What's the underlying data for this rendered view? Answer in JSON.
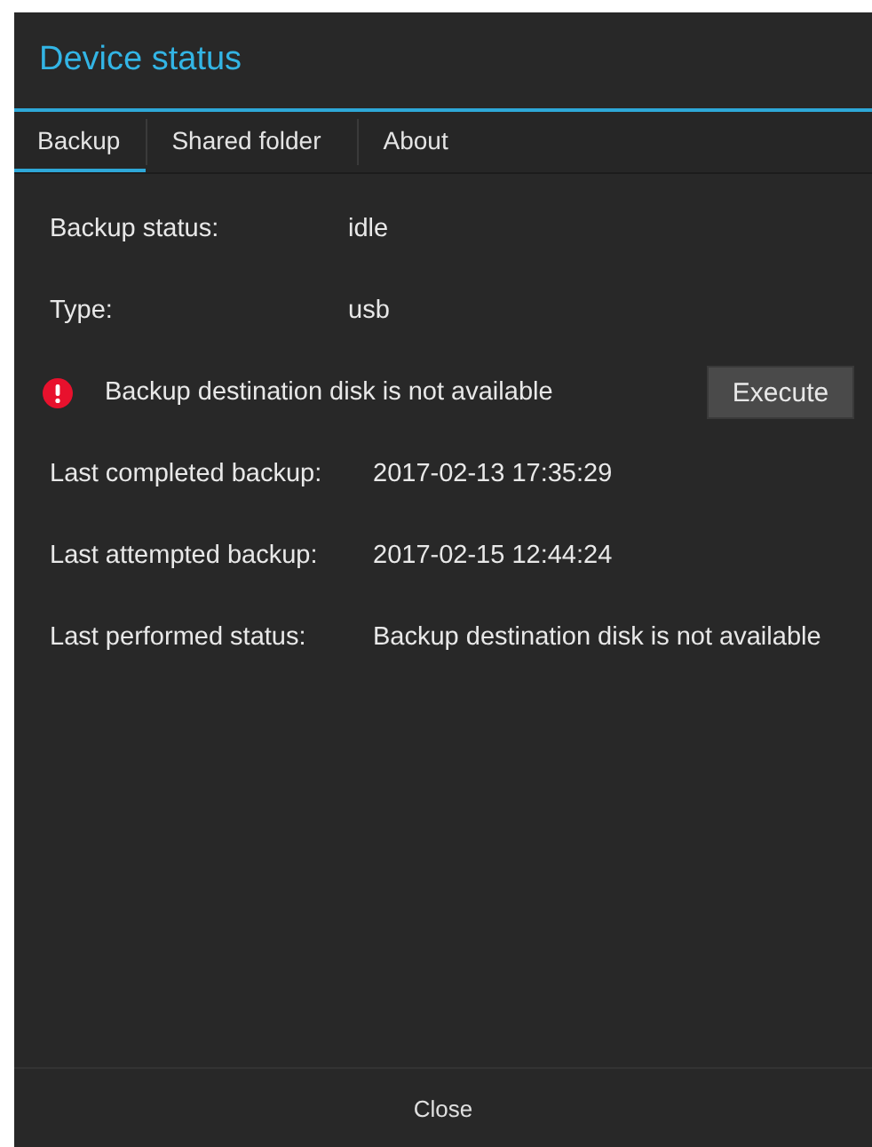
{
  "dialog": {
    "title": "Device status"
  },
  "tabs": [
    {
      "label": "Backup",
      "selected": true
    },
    {
      "label": "Shared folder",
      "selected": false
    },
    {
      "label": "About",
      "selected": false
    }
  ],
  "status": [
    {
      "label": "Backup status:",
      "value": "idle"
    },
    {
      "label": "Type:",
      "value": "usb"
    }
  ],
  "alert": {
    "message": "Backup destination disk is not available",
    "button": "Execute"
  },
  "history": [
    {
      "label": "Last completed backup:",
      "value": "2017-02-13 17:35:29"
    },
    {
      "label": "Last attempted backup:",
      "value": "2017-02-15 12:44:24"
    },
    {
      "label": "Last performed status:",
      "value": "Backup destination disk is not available"
    }
  ],
  "footer": {
    "button": "Close"
  }
}
